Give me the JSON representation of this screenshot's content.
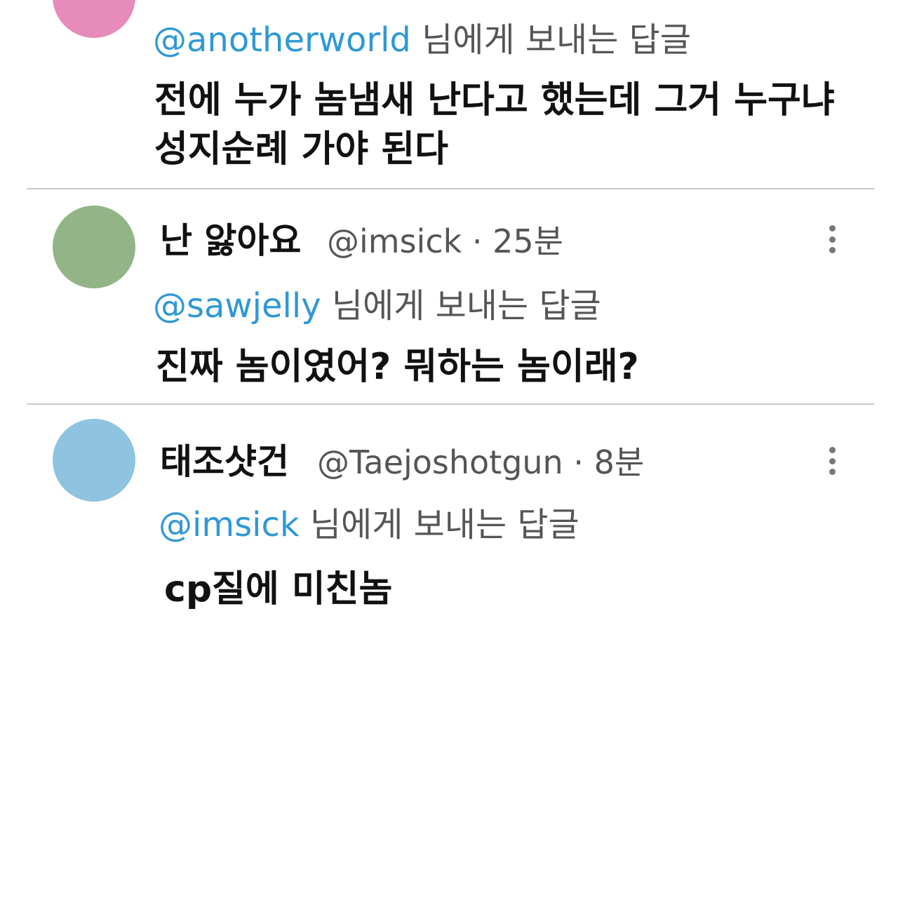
{
  "tweets": [
    {
      "avatar_color": "#e68bba",
      "reply_to": {
        "mention": "@anotherworld",
        "suffix": "님에게 보내는 답글"
      },
      "body_lines": [
        "전에 누가 놈냄새 난다고 했는데 그거 누구냐",
        "성지순례 가야 된다"
      ]
    },
    {
      "avatar_color": "#93b487",
      "display_name": "난 앓아요",
      "handle": "@imsick",
      "separator": "·",
      "time": "25분",
      "more_icon": "more-vertical-icon",
      "reply_to": {
        "mention": "@sawjelly",
        "suffix": "님에게 보내는 답글"
      },
      "body_lines": [
        "진짜 놈이였어? 뭐하는 놈이래?"
      ]
    },
    {
      "avatar_color": "#8ec4e0",
      "display_name": "태조샷건",
      "handle": "@Taejoshotgun",
      "separator": "·",
      "time": "8분",
      "more_icon": "more-vertical-icon",
      "reply_to": {
        "mention": "@imsick",
        "suffix": "님에게 보내는 답글"
      },
      "body_lines": [
        "cp질에 미친놈"
      ]
    }
  ],
  "colors": {
    "mention": "#2f98d6",
    "meta": "#555555",
    "divider": "#c9c9c9"
  }
}
